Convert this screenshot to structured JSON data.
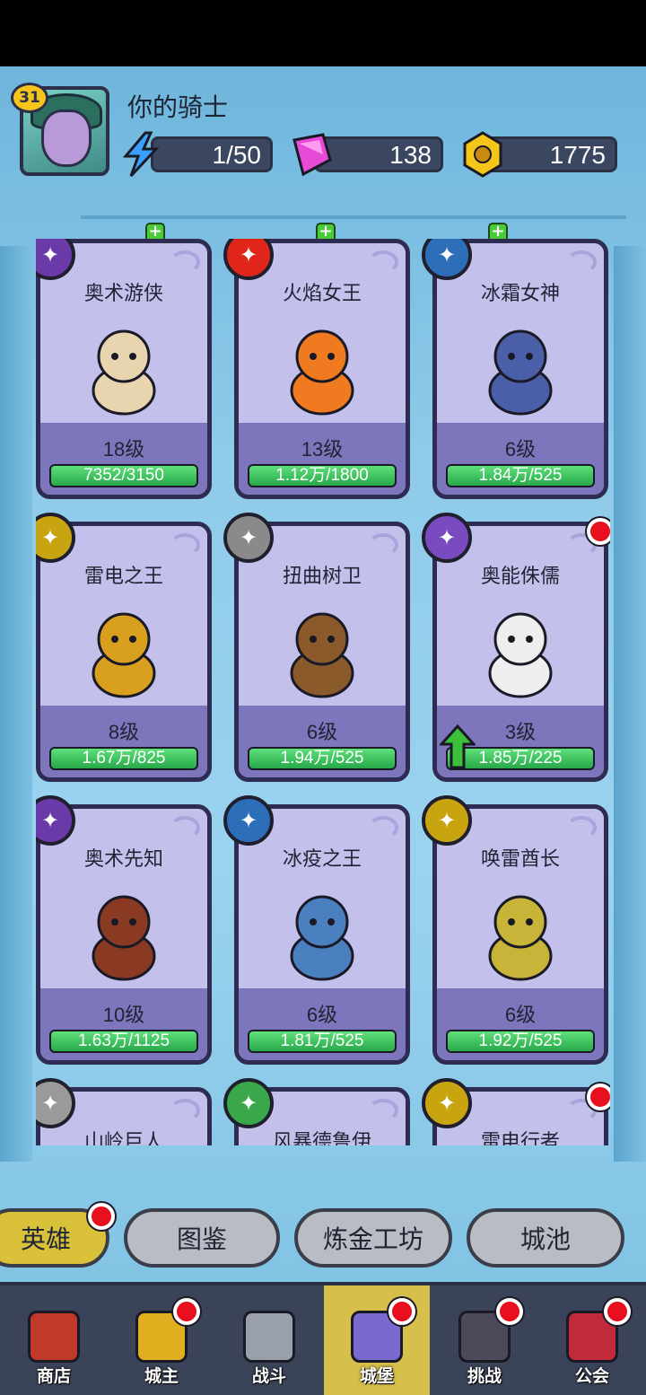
{
  "player": {
    "level": "31",
    "name": "你的骑士",
    "energy": "1/50",
    "gems": "138",
    "gold": "1775"
  },
  "heroes": [
    {
      "name": "奥术游侠",
      "level": "18级",
      "progress": "7352/3150",
      "element": "arcane-arrows-icon",
      "fill": 1.0,
      "dot": false,
      "up": false
    },
    {
      "name": "火焰女王",
      "level": "13级",
      "progress": "1.12万/1800",
      "element": "fire-ring-icon",
      "fill": 1.0,
      "dot": false,
      "up": false
    },
    {
      "name": "冰霜女神",
      "level": "6级",
      "progress": "1.84万/525",
      "element": "ice-crystal-icon",
      "fill": 1.0,
      "dot": false,
      "up": false
    },
    {
      "name": "雷电之王",
      "level": "8级",
      "progress": "1.67万/825",
      "element": "lightning-icon",
      "fill": 1.0,
      "dot": false,
      "up": false
    },
    {
      "name": "扭曲树卫",
      "level": "6级",
      "progress": "1.94万/525",
      "element": "stone-icon",
      "fill": 1.0,
      "dot": false,
      "up": false
    },
    {
      "name": "奥能侏儒",
      "level": "3级",
      "progress": "1.85万/225",
      "element": "arcane-claw-icon",
      "fill": 1.0,
      "dot": true,
      "up": true
    },
    {
      "name": "奥术先知",
      "level": "10级",
      "progress": "1.63万/1125",
      "element": "arcane-arrows-icon",
      "fill": 1.0,
      "dot": false,
      "up": false
    },
    {
      "name": "冰疫之王",
      "level": "6级",
      "progress": "1.81万/525",
      "element": "ice-crystal-icon",
      "fill": 1.0,
      "dot": false,
      "up": false
    },
    {
      "name": "唤雷酋长",
      "level": "6级",
      "progress": "1.92万/525",
      "element": "lightning-icon",
      "fill": 1.0,
      "dot": false,
      "up": false
    },
    {
      "name": "山岭巨人",
      "level": "",
      "progress": "",
      "element": "mountain-icon",
      "fill": 0,
      "dot": false,
      "up": false
    },
    {
      "name": "风暴德鲁伊",
      "level": "",
      "progress": "",
      "element": "wind-icon",
      "fill": 0,
      "dot": false,
      "up": false
    },
    {
      "name": "雷电行者",
      "level": "",
      "progress": "",
      "element": "lightning-icon",
      "fill": 0,
      "dot": true,
      "up": false
    }
  ],
  "tabs": [
    {
      "label": "英雄",
      "active": true,
      "dot": true
    },
    {
      "label": "图鉴",
      "active": false,
      "dot": false
    },
    {
      "label": "炼金工坊",
      "active": false,
      "dot": false
    },
    {
      "label": "城池",
      "active": false,
      "dot": false
    }
  ],
  "nav": [
    {
      "label": "商店",
      "icon": "shop-icon",
      "active": false,
      "dot": false
    },
    {
      "label": "城主",
      "icon": "crown-icon",
      "active": false,
      "dot": true
    },
    {
      "label": "战斗",
      "icon": "crossed-swords-icon",
      "active": false,
      "dot": false
    },
    {
      "label": "城堡",
      "icon": "castle-icon",
      "active": true,
      "dot": true
    },
    {
      "label": "挑战",
      "icon": "demon-icon",
      "active": false,
      "dot": true
    },
    {
      "label": "公会",
      "icon": "guild-banner-icon",
      "active": false,
      "dot": true
    }
  ],
  "colors": {
    "card_bg": "#c3c1ec",
    "card_band": "#7d76bc",
    "bar_fill": "#27a84a",
    "active_tab": "#d9c13a",
    "red_dot": "#e8101e"
  }
}
